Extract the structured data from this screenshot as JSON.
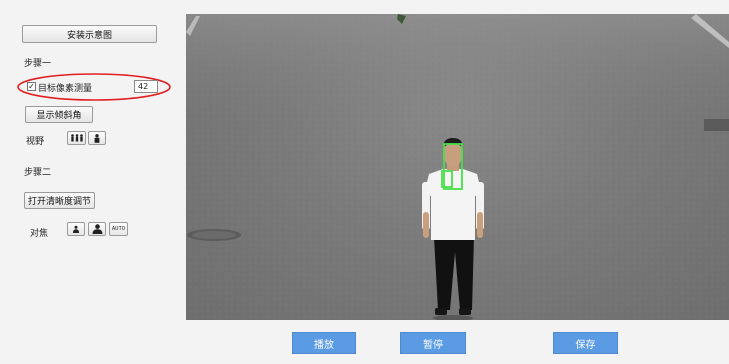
{
  "sidebar": {
    "install_diagram_button": "安装示意图",
    "step1_label": "步骤一",
    "target_pixel_checkbox_label": "目标像素测量",
    "target_pixel_checked": true,
    "target_pixel_value": "42",
    "show_tilt_button": "显示倾斜角",
    "view_label": "视野",
    "step2_label": "步骤二",
    "open_clarity_button": "打开清晰度调节",
    "focus_label": "对焦",
    "focus_auto_label": "AUTO"
  },
  "controls": {
    "play_label": "播放",
    "pause_label": "暂停",
    "save_label": "保存"
  },
  "colors": {
    "accent_blue": "#5b9be3",
    "highlight_ellipse": "#e02020",
    "detection_box": "#46e04a"
  },
  "icons": {
    "view_wide": "people-group-icon",
    "view_narrow": "person-icon",
    "focus_near": "person-small-icon",
    "focus_far": "person-large-icon"
  }
}
